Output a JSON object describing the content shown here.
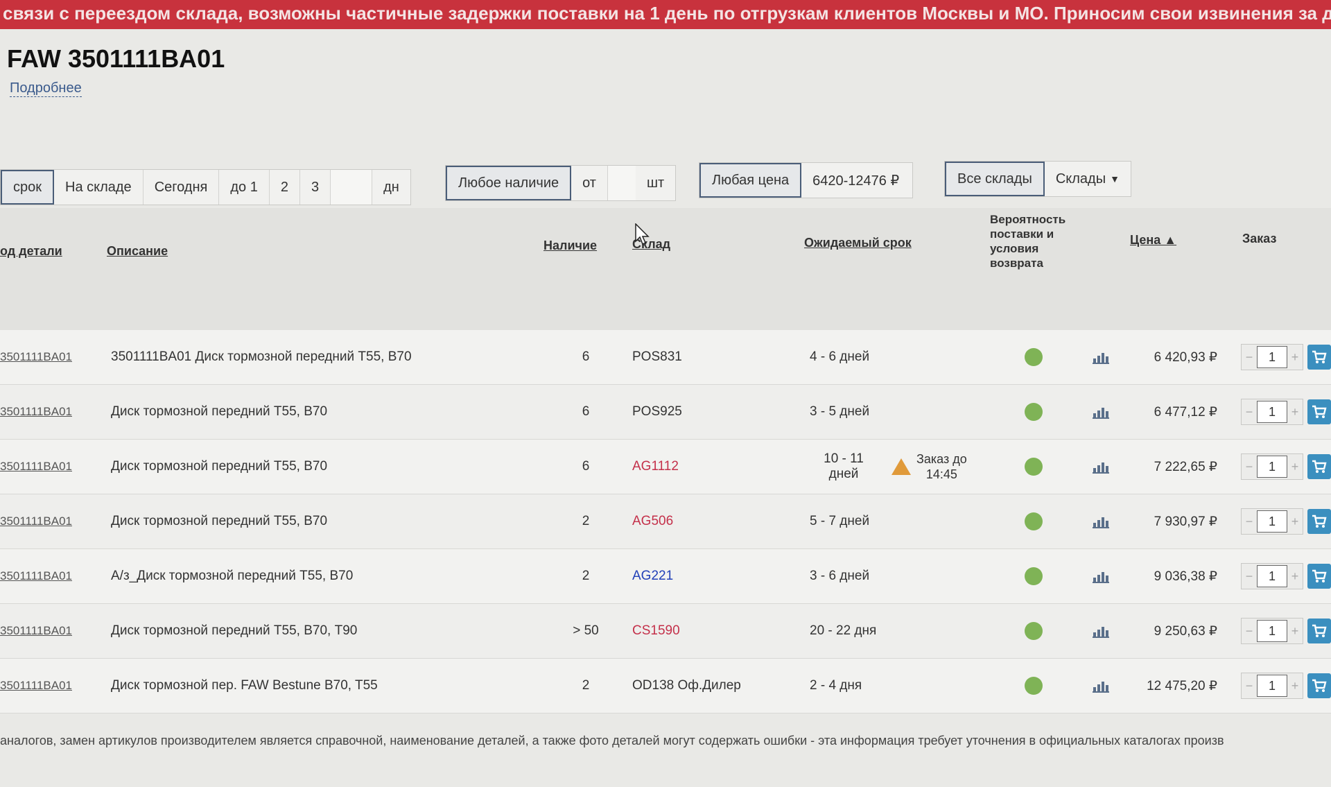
{
  "banner": "связи с переездом склада, возможны частичные задержки поставки на 1 день по отгрузкам клиентов Москвы и МО. Приносим свои извинения за доставленные",
  "title": "FAW 3501111BA01",
  "more_link": "Подробнее",
  "filters": {
    "term": [
      "срок",
      "На складе",
      "Сегодня",
      "до 1",
      "2",
      "3",
      "",
      "дн"
    ],
    "availability": {
      "any": "Любое наличие",
      "from": "от",
      "unit": "шт"
    },
    "price": {
      "any": "Любая цена",
      "range": "6420-12476 ₽"
    },
    "warehouses": {
      "all": "Все склады",
      "menu": "Склады"
    }
  },
  "columns": {
    "code": "од детали",
    "description": "Описание",
    "stock": "Наличие",
    "warehouse": "Склад",
    "lead_time": "Ожидаемый срок",
    "probability": [
      "Вероятность",
      "поставки и",
      "условия",
      "возврата"
    ],
    "price": "Цена ▲",
    "order": "Заказ"
  },
  "rows": [
    {
      "code": "3501111BA01",
      "description": "3501111BA01 Диск тормозной передний Т55, В70",
      "stock": "6",
      "warehouse": "POS831",
      "wh_color": "default",
      "lead": "4 - 6 дней",
      "price": "6 420,93 ₽",
      "qty": "1"
    },
    {
      "code": "3501111BA01",
      "description": "Диск тормозной передний Т55, В70",
      "stock": "6",
      "warehouse": "POS925",
      "wh_color": "default",
      "lead": "3 - 5 дней",
      "price": "6 477,12 ₽",
      "qty": "1"
    },
    {
      "code": "3501111BA01",
      "description": "Диск тормозной передний Т55, В70",
      "stock": "6",
      "warehouse": "AG1112",
      "wh_color": "red",
      "lead": "10 - 11",
      "lead2": "дней",
      "cutoff": "Заказ до",
      "cutoff2": "14:45",
      "price": "7 222,65 ₽",
      "qty": "1"
    },
    {
      "code": "3501111BA01",
      "description": "Диск тормозной передний Т55, В70",
      "stock": "2",
      "warehouse": "AG506",
      "wh_color": "red",
      "lead": "5 - 7 дней",
      "price": "7 930,97 ₽",
      "qty": "1"
    },
    {
      "code": "3501111BA01",
      "description": "А/з_Диск тормозной передний Т55, В70",
      "stock": "2",
      "warehouse": "AG221",
      "wh_color": "blue",
      "lead": "3 - 6 дней",
      "price": "9 036,38 ₽",
      "qty": "1"
    },
    {
      "code": "3501111BA01",
      "description": "Диск тормозной передний Т55, В70, Т90",
      "stock": "> 50",
      "warehouse": "CS1590",
      "wh_color": "red",
      "lead": "20 - 22 дня",
      "price": "9 250,63 ₽",
      "qty": "1"
    },
    {
      "code": "3501111BA01",
      "description": "Диск тормозной пер. FAW Bestune B70, T55",
      "stock": "2",
      "warehouse": "OD138 Оф.Дилер",
      "wh_color": "default",
      "lead": "2 - 4 дня",
      "price": "12 475,20 ₽",
      "qty": "1"
    }
  ],
  "stepper": {
    "minus": "−",
    "plus": "+"
  },
  "footer_note": "аналогов, замен артикулов производителем является справочной, наименование деталей, а также фото деталей могут содержать ошибки - эта информация требует уточнения в официальных каталогах произв",
  "colors": {
    "banner": "#c8323d",
    "ok_dot": "#7fb356",
    "cart": "#3b8fbf",
    "warn": "#e09a3a"
  }
}
